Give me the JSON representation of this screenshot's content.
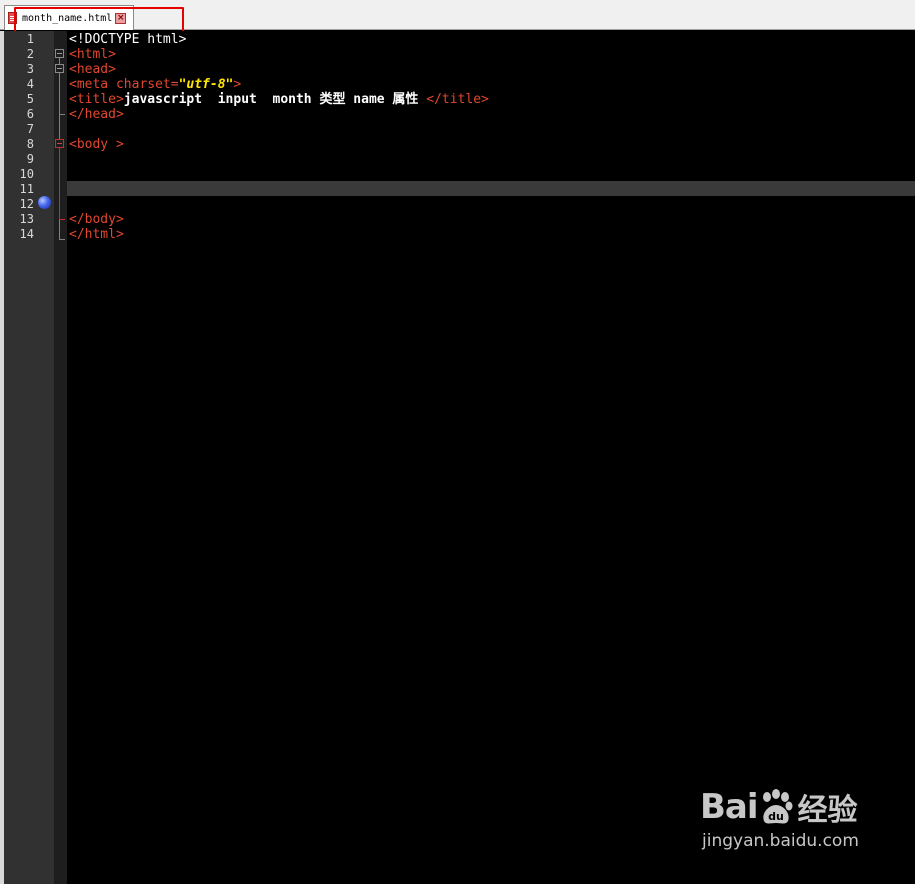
{
  "tab": {
    "filename": "month_name.html",
    "close_symbol": "×"
  },
  "gutter": {
    "line_numbers": [
      "1",
      "2",
      "3",
      "4",
      "5",
      "6",
      "7",
      "8",
      "9",
      "10",
      "11",
      "12",
      "13",
      "14"
    ],
    "bookmark_line": 12,
    "current_line": 11
  },
  "code": {
    "line1": "<!DOCTYPE html>",
    "line2_tag": "<html>",
    "line3_tag": "<head>",
    "line4_open": "<meta charset=",
    "line4_value": "\"utf-8\"",
    "line4_close": ">",
    "line5_open": "<title>",
    "line5_text": "javascript  input  month 类型 name 属性 ",
    "line5_close": "</title>",
    "line6_tag": "</head>",
    "line7": "",
    "line8_tag": "<body >",
    "line9": "",
    "line10": "",
    "line11": "",
    "line12": "",
    "line13_tag": "</body>",
    "line14_tag": "</html>"
  },
  "watermark": {
    "brand_left": "Bai",
    "brand_right": "经验",
    "url": "jingyan.baidu.com"
  },
  "colors": {
    "tag": "#e0472f",
    "string": "#ffe600",
    "text": "#ffffff",
    "background": "#000000",
    "gutter": "#313131",
    "current_line": "#3a3a3a",
    "highlight_box": "#e60000"
  },
  "icons": [
    "html-file-icon",
    "tab-close-icon",
    "fold-minus-icon",
    "bookmark-icon"
  ]
}
